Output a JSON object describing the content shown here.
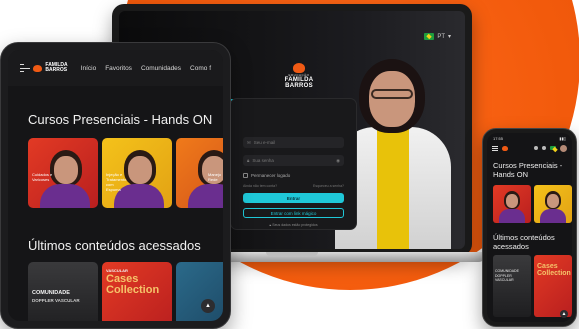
{
  "laptop": {
    "language": "PT",
    "brand": {
      "small": "EDUCAÇÃO",
      "line1": "FAMILDA",
      "line2": "BARROS"
    },
    "login": {
      "email_placeholder": "Seu e-mail",
      "password_placeholder": "Sua senha",
      "remember_label": "Permanecer logado",
      "signup_link": "Ainda não tem conta?",
      "forgot_link": "Esqueceu a senha?",
      "enter_button": "Entrar",
      "magic_link_button": "Entrar com link mágico",
      "privacy_note": "Seus dados estão protegidos"
    }
  },
  "tablet": {
    "brand": {
      "small": "EDUCAÇÃO",
      "line1": "FAMILDA",
      "line2": "BARROS"
    },
    "nav": [
      "Início",
      "Favoritos",
      "Comunidades",
      "Como f"
    ],
    "section1_title": "Cursos Presenciais - Hands ON",
    "section1_cards": [
      {
        "caption": "Cuidados e Varicoses",
        "color": "red"
      },
      {
        "caption": "Injeção e Tratamento com Espuma",
        "color": "yellow"
      },
      {
        "caption": "Manejo Rede",
        "color": "orange"
      }
    ],
    "section2_title": "Últimos conteúdos acessados",
    "section2_cards": [
      {
        "label_line1": "COMUNIDADE",
        "label_line2": "DOPPLER VASCULAR"
      },
      {
        "label_line1": "VASCULAR",
        "big_line1": "Cases",
        "big_line2": "Collection"
      }
    ]
  },
  "phone": {
    "time": "17:55",
    "title_line1": "Cursos Presenciais -",
    "title_line2": "Hands ON",
    "section2_line1": "Últimos conteúdos",
    "section2_line2": "acessados",
    "card_label_line1": "COMUNIDADE",
    "card_label_line2": "DOPPLER VASCULAR",
    "card_big_line1": "Cases",
    "card_big_line2": "Collection"
  }
}
